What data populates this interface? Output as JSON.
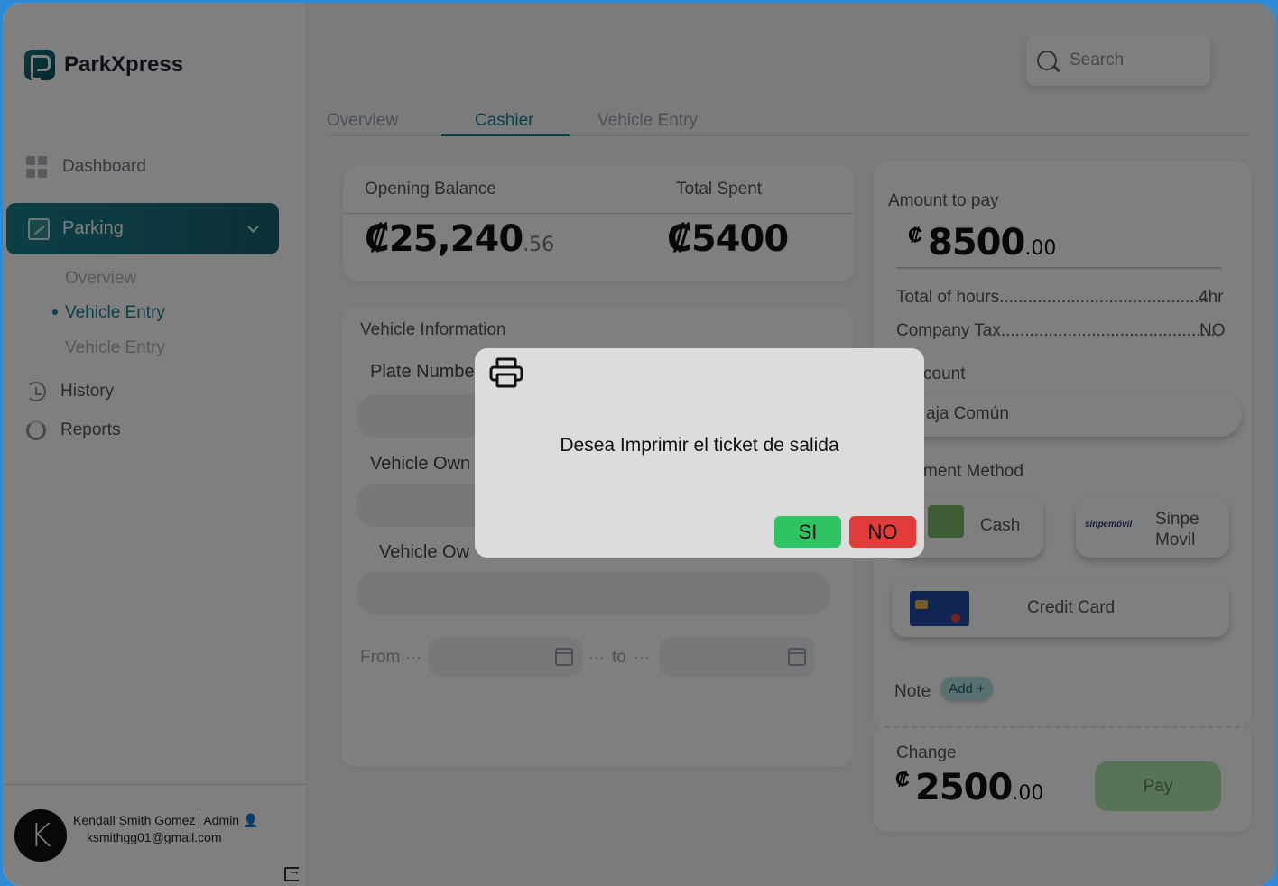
{
  "brand": {
    "name": "ParkXpress"
  },
  "sidebar": {
    "dashboard": "Dashboard",
    "parking": "Parking",
    "sub_items": [
      "Overview",
      "Vehicle Entry",
      "Vehicle Entry"
    ],
    "history": "History",
    "reports": "Reports"
  },
  "user": {
    "name": "Kendall Smith Gomez",
    "role": "Admin",
    "email": "ksmithgg01@gmail.com",
    "initial": "K"
  },
  "search": {
    "placeholder": "Search"
  },
  "tabs": [
    "Overview",
    "Cashier",
    "Vehicle Entry"
  ],
  "balance": {
    "opening_label": "Opening Balance",
    "opening_main": "₡25,240",
    "opening_decimal": ".56",
    "spent_label": "Total Spent",
    "spent_value": "₡5400"
  },
  "vehicle": {
    "title": "Vehicle Information",
    "plate_label": "Plate Numbe",
    "owner_label_1": "Vehicle Own",
    "owner_label_2": "Vehicle Ow",
    "from": "From",
    "to": "to"
  },
  "payment": {
    "amount_label": "Amount to pay",
    "currency": "₡",
    "amount_main": "8500",
    "amount_decimal": ".00",
    "hours_label": "Total of hours............................................",
    "hours_value": "4hr",
    "tax_label": "Company Tax.............................................",
    "tax_value": "NO",
    "account_label": "count",
    "account_value": "aja Común",
    "method_label": "ment Method",
    "cash": "Cash",
    "sinpe_line1": "Sinpe",
    "sinpe_line2": "Movil",
    "sinpe_logo": "sinpemóvil",
    "credit": "Credit Card",
    "note_label": "Note",
    "note_add": "Add +",
    "change_label": "Change",
    "change_main": "2500",
    "change_decimal": ".00",
    "pay_button": "Pay"
  },
  "modal": {
    "message": "Desea Imprimir el ticket de salida",
    "yes": "SI",
    "no": "NO"
  }
}
